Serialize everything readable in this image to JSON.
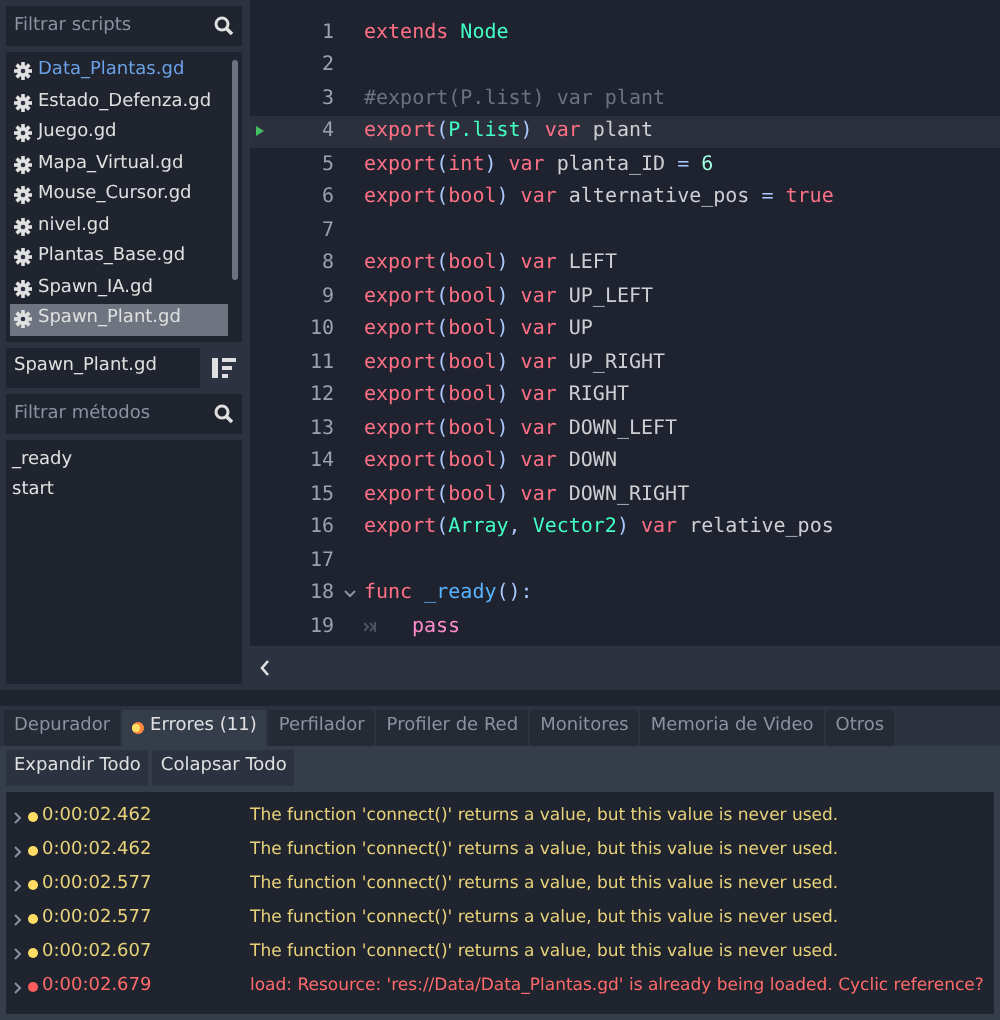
{
  "scripts_panel": {
    "filter_placeholder": "Filtrar scripts",
    "scripts": [
      {
        "name": "Data_Plantas.gd",
        "selected": false,
        "highlighted": true
      },
      {
        "name": "Estado_Defenza.gd",
        "selected": false,
        "highlighted": false
      },
      {
        "name": "Juego.gd",
        "selected": false,
        "highlighted": false
      },
      {
        "name": "Mapa_Virtual.gd",
        "selected": false,
        "highlighted": false
      },
      {
        "name": "Mouse_Cursor.gd",
        "selected": false,
        "highlighted": false
      },
      {
        "name": "nivel.gd",
        "selected": false,
        "highlighted": false
      },
      {
        "name": "Plantas_Base.gd",
        "selected": false,
        "highlighted": false
      },
      {
        "name": "Spawn_IA.gd",
        "selected": false,
        "highlighted": false
      },
      {
        "name": "Spawn_Plant.gd",
        "selected": true,
        "highlighted": false
      }
    ],
    "current_script": "Spawn_Plant.gd",
    "methods_placeholder": "Filtrar métodos",
    "methods": [
      "_ready",
      "start"
    ]
  },
  "editor": {
    "lines": [
      {
        "number": "1",
        "current": false,
        "tokens": [
          {
            "kind": "keyword",
            "text": "extends "
          },
          {
            "kind": "type",
            "text": "Node"
          }
        ]
      },
      {
        "number": "2",
        "current": false
      },
      {
        "number": "3",
        "current": false,
        "tokens": [
          {
            "kind": "comment",
            "text": "#export(P.list) var plant"
          }
        ]
      },
      {
        "number": "4",
        "current": true,
        "tokens": [
          {
            "kind": "keyword",
            "text": "export"
          },
          {
            "kind": "symbol",
            "text": "("
          },
          {
            "kind": "type",
            "text": "P.list"
          },
          {
            "kind": "symbol",
            "text": ") "
          },
          {
            "kind": "keyword",
            "text": "var "
          },
          {
            "kind": "plain",
            "text": "plant"
          }
        ]
      },
      {
        "number": "5",
        "current": false,
        "tokens": [
          {
            "kind": "keyword",
            "text": "export"
          },
          {
            "kind": "symbol",
            "text": "("
          },
          {
            "kind": "keyword",
            "text": "int"
          },
          {
            "kind": "symbol",
            "text": ") "
          },
          {
            "kind": "keyword",
            "text": "var "
          },
          {
            "kind": "plain",
            "text": "planta_ID "
          },
          {
            "kind": "symbol",
            "text": "= "
          },
          {
            "kind": "number",
            "text": "6"
          }
        ]
      },
      {
        "number": "6",
        "current": false,
        "tokens": [
          {
            "kind": "keyword",
            "text": "export"
          },
          {
            "kind": "symbol",
            "text": "("
          },
          {
            "kind": "keyword",
            "text": "bool"
          },
          {
            "kind": "symbol",
            "text": ") "
          },
          {
            "kind": "keyword",
            "text": "var "
          },
          {
            "kind": "plain",
            "text": "alternative_pos "
          },
          {
            "kind": "symbol",
            "text": "= "
          },
          {
            "kind": "keyword",
            "text": "true"
          }
        ]
      },
      {
        "number": "7",
        "current": false
      },
      {
        "number": "8",
        "current": false,
        "tokens": [
          {
            "kind": "keyword",
            "text": "export"
          },
          {
            "kind": "symbol",
            "text": "("
          },
          {
            "kind": "keyword",
            "text": "bool"
          },
          {
            "kind": "symbol",
            "text": ") "
          },
          {
            "kind": "keyword",
            "text": "var "
          },
          {
            "kind": "plain",
            "text": "LEFT"
          }
        ]
      },
      {
        "number": "9",
        "current": false,
        "tokens": [
          {
            "kind": "keyword",
            "text": "export"
          },
          {
            "kind": "symbol",
            "text": "("
          },
          {
            "kind": "keyword",
            "text": "bool"
          },
          {
            "kind": "symbol",
            "text": ") "
          },
          {
            "kind": "keyword",
            "text": "var "
          },
          {
            "kind": "plain",
            "text": "UP_LEFT"
          }
        ]
      },
      {
        "number": "10",
        "current": false,
        "tokens": [
          {
            "kind": "keyword",
            "text": "export"
          },
          {
            "kind": "symbol",
            "text": "("
          },
          {
            "kind": "keyword",
            "text": "bool"
          },
          {
            "kind": "symbol",
            "text": ") "
          },
          {
            "kind": "keyword",
            "text": "var "
          },
          {
            "kind": "plain",
            "text": "UP"
          }
        ]
      },
      {
        "number": "11",
        "current": false,
        "tokens": [
          {
            "kind": "keyword",
            "text": "export"
          },
          {
            "kind": "symbol",
            "text": "("
          },
          {
            "kind": "keyword",
            "text": "bool"
          },
          {
            "kind": "symbol",
            "text": ") "
          },
          {
            "kind": "keyword",
            "text": "var "
          },
          {
            "kind": "plain",
            "text": "UP_RIGHT"
          }
        ]
      },
      {
        "number": "12",
        "current": false,
        "tokens": [
          {
            "kind": "keyword",
            "text": "export"
          },
          {
            "kind": "symbol",
            "text": "("
          },
          {
            "kind": "keyword",
            "text": "bool"
          },
          {
            "kind": "symbol",
            "text": ") "
          },
          {
            "kind": "keyword",
            "text": "var "
          },
          {
            "kind": "plain",
            "text": "RIGHT"
          }
        ]
      },
      {
        "number": "13",
        "current": false,
        "tokens": [
          {
            "kind": "keyword",
            "text": "export"
          },
          {
            "kind": "symbol",
            "text": "("
          },
          {
            "kind": "keyword",
            "text": "bool"
          },
          {
            "kind": "symbol",
            "text": ") "
          },
          {
            "kind": "keyword",
            "text": "var "
          },
          {
            "kind": "plain",
            "text": "DOWN_LEFT"
          }
        ]
      },
      {
        "number": "14",
        "current": false,
        "tokens": [
          {
            "kind": "keyword",
            "text": "export"
          },
          {
            "kind": "symbol",
            "text": "("
          },
          {
            "kind": "keyword",
            "text": "bool"
          },
          {
            "kind": "symbol",
            "text": ") "
          },
          {
            "kind": "keyword",
            "text": "var "
          },
          {
            "kind": "plain",
            "text": "DOWN"
          }
        ]
      },
      {
        "number": "15",
        "current": false,
        "tokens": [
          {
            "kind": "keyword",
            "text": "export"
          },
          {
            "kind": "symbol",
            "text": "("
          },
          {
            "kind": "keyword",
            "text": "bool"
          },
          {
            "kind": "symbol",
            "text": ") "
          },
          {
            "kind": "keyword",
            "text": "var "
          },
          {
            "kind": "plain",
            "text": "DOWN_RIGHT"
          }
        ]
      },
      {
        "number": "16",
        "current": false,
        "tokens": [
          {
            "kind": "keyword",
            "text": "export"
          },
          {
            "kind": "symbol",
            "text": "("
          },
          {
            "kind": "type",
            "text": "Array"
          },
          {
            "kind": "symbol",
            "text": ", "
          },
          {
            "kind": "type",
            "text": "Vector2"
          },
          {
            "kind": "symbol",
            "text": ") "
          },
          {
            "kind": "keyword",
            "text": "var "
          },
          {
            "kind": "plain",
            "text": "relative_pos"
          }
        ]
      },
      {
        "number": "17",
        "current": false
      },
      {
        "number": "18",
        "current": false,
        "foldable": true,
        "tokens": [
          {
            "kind": "keyword",
            "text": "func "
          },
          {
            "kind": "function",
            "text": "_ready"
          },
          {
            "kind": "symbol",
            "text": "():"
          }
        ]
      },
      {
        "number": "19",
        "current": false,
        "indented": true,
        "tokens": [
          {
            "kind": "control",
            "text": "pass"
          }
        ]
      }
    ]
  },
  "debugger": {
    "tabs": [
      {
        "label": "Depurador",
        "selected": false,
        "has_error": false
      },
      {
        "label": "Errores (11)",
        "selected": true,
        "has_error": true
      },
      {
        "label": "Perfilador",
        "selected": false,
        "has_error": false
      },
      {
        "label": "Profiler de Red",
        "selected": false,
        "has_error": false
      },
      {
        "label": "Monitores",
        "selected": false,
        "has_error": false
      },
      {
        "label": "Memoria de Video",
        "selected": false,
        "has_error": false
      },
      {
        "label": "Otros",
        "selected": false,
        "has_error": false
      }
    ],
    "buttons": [
      "Expandir Todo",
      "Colapsar Todo"
    ],
    "messages": [
      {
        "kind": "warning",
        "time": "0:00:02.462",
        "text": "The function 'connect()' returns a value, but this value is never used."
      },
      {
        "kind": "warning",
        "time": "0:00:02.462",
        "text": "The function 'connect()' returns a value, but this value is never used."
      },
      {
        "kind": "warning",
        "time": "0:00:02.577",
        "text": "The function 'connect()' returns a value, but this value is never used."
      },
      {
        "kind": "warning",
        "time": "0:00:02.577",
        "text": "The function 'connect()' returns a value, but this value is never used."
      },
      {
        "kind": "warning",
        "time": "0:00:02.607",
        "text": "The function 'connect()' returns a value, but this value is never used."
      },
      {
        "kind": "error",
        "time": "0:00:02.679",
        "text": "load: Resource: 'res://Data/Data_Plantas.gd' is already being loaded. Cyclic reference?"
      }
    ]
  }
}
